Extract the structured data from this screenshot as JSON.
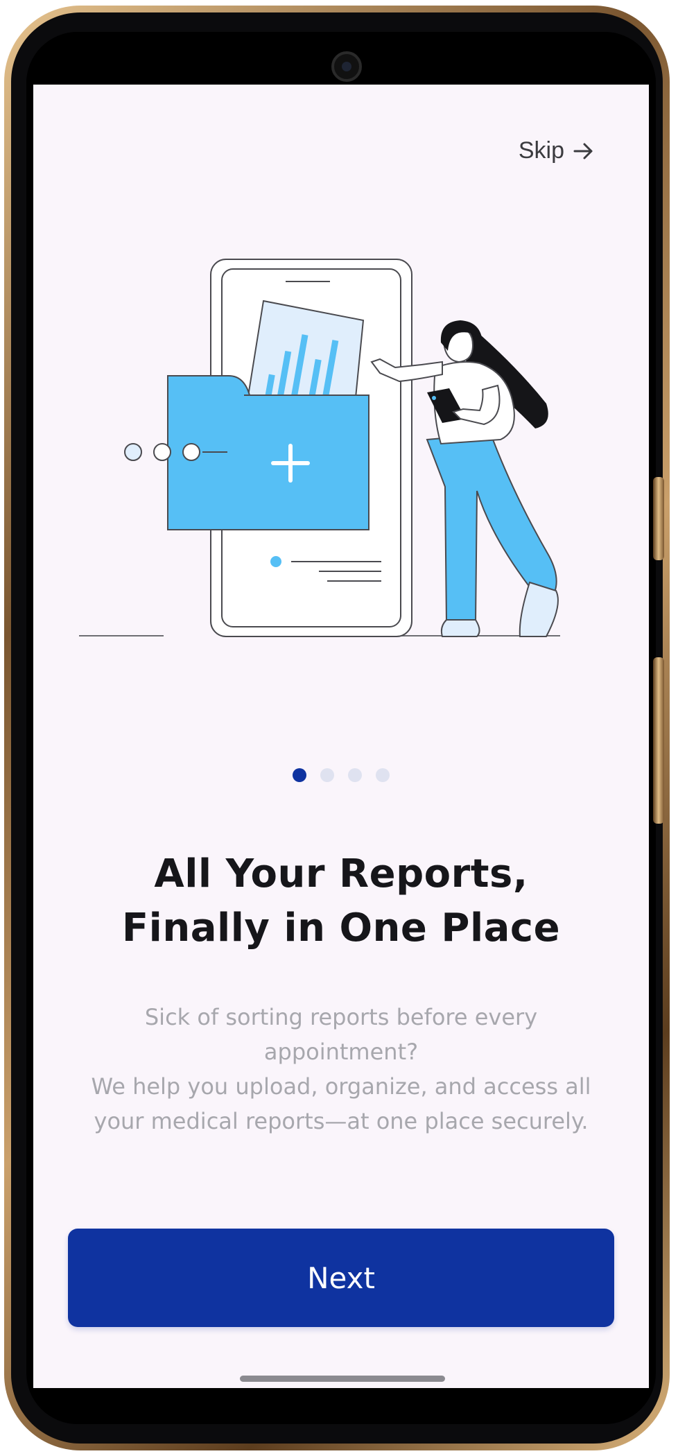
{
  "skip": {
    "label": "Skip",
    "icon": "arrow-right-icon"
  },
  "pagination": {
    "total": 4,
    "current": 1
  },
  "title_line1": "All Your Reports,",
  "title_line2": "Finally in One Place",
  "body": [
    "Sick of sorting reports before every appointment?",
    "We help you upload, organize, and access all your medical reports—at one place securely."
  ],
  "next_button": {
    "label": "Next"
  },
  "colors": {
    "primary": "#0f33a0",
    "background": "#faf5fb",
    "illustration_blue": "#56bff5",
    "text_muted": "#a7a7ad"
  }
}
